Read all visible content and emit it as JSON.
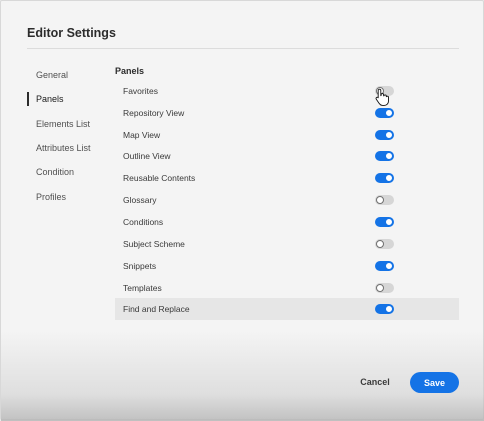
{
  "dialog": {
    "title": "Editor Settings"
  },
  "nav": {
    "items": [
      {
        "label": "General",
        "active": false
      },
      {
        "label": "Panels",
        "active": true
      },
      {
        "label": "Elements List",
        "active": false
      },
      {
        "label": "Attributes List",
        "active": false
      },
      {
        "label": "Condition",
        "active": false
      },
      {
        "label": "Profiles",
        "active": false
      }
    ]
  },
  "panels": {
    "heading": "Panels",
    "rows": [
      {
        "label": "Favorites",
        "enabled": false
      },
      {
        "label": "Repository View",
        "enabled": true
      },
      {
        "label": "Map View",
        "enabled": true
      },
      {
        "label": "Outline View",
        "enabled": true
      },
      {
        "label": "Reusable Contents",
        "enabled": true
      },
      {
        "label": "Glossary",
        "enabled": false
      },
      {
        "label": "Conditions",
        "enabled": true
      },
      {
        "label": "Subject Scheme",
        "enabled": false
      },
      {
        "label": "Snippets",
        "enabled": true
      },
      {
        "label": "Templates",
        "enabled": false
      },
      {
        "label": "Find and Replace",
        "enabled": true
      }
    ]
  },
  "footer": {
    "cancel_label": "Cancel",
    "save_label": "Save"
  },
  "colors": {
    "accent": "#1473e6",
    "toggle_off": "#d6d6d6",
    "background": "#f4f4f4"
  },
  "icons": {
    "cursor": "hand-pointer-icon"
  }
}
